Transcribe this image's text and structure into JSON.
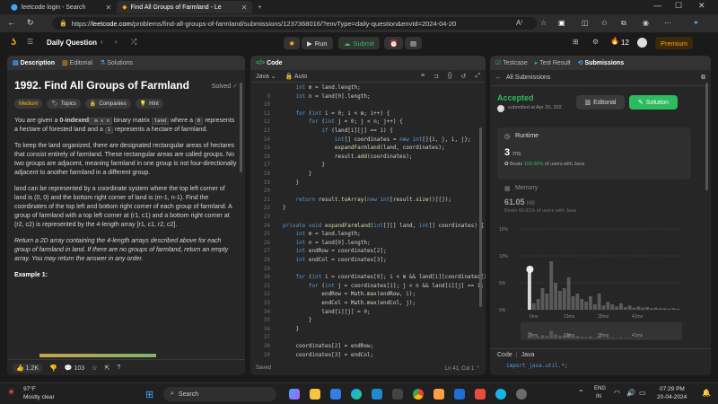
{
  "browser": {
    "tabs": [
      {
        "label": "leetcode login - Search"
      },
      {
        "label": "Find All Groups of Farmland - Le"
      }
    ],
    "url_prefix": "https://",
    "url_host": "leetcode.com",
    "url_path": "/problems/find-all-groups-of-farmland/submissions/1237368016/?envType=daily-question&envId=2024-04-20"
  },
  "header": {
    "daily_label": "Daily Question",
    "run_label": "Run",
    "submit_label": "Submit",
    "streak": "12",
    "premium_label": "Premium"
  },
  "left_panel": {
    "tabs": [
      "Description",
      "Editorial",
      "Solutions"
    ],
    "title": "1992. Find All Groups of Farmland",
    "solved_label": "Solved",
    "pills": [
      "Medium",
      "Topics",
      "Companies",
      "Hint"
    ],
    "p1": {
      "a": "You are given a ",
      "b": "0-indexed",
      "c": " m x n",
      "d": " binary matrix ",
      "e": "land",
      "f": " where a ",
      "g": "0",
      "h": "represents a hectare of forested land and a ",
      "i": "1",
      "j": " represents a hectare of farmland."
    },
    "p2": "To keep the land organized, there are designated rectangular areas of hectares that consist entirely of farmland. These rectangular areas are called groups. No two groups are adjacent, meaning farmland in one group is not four-directionally adjacent to another farmland in a different group.",
    "p3": "land can be represented by a coordinate system where the top left corner of land is (0, 0) and the bottom right corner of land is (m-1, n-1). Find the coordinates of the top left and bottom right corner of each group of farmland. A group of farmland with a top left corner at (r1, c1) and a bottom right corner at (r2, c2) is represented by the 4-length array [r1, c1, r2, c2].",
    "p4": "Return a 2D array containing the 4-length arrays described above for each group of farmland in land. If there are no groups of farmland, return an empty array. You may return the answer in any order.",
    "example_label": "Example 1:",
    "likes": "1.2K",
    "comments": "103"
  },
  "code_panel": {
    "title": "Code",
    "language": "Java",
    "auto_label": "Auto",
    "status_saved": "Saved",
    "cursor_pos": "Ln 41, Col 1",
    "lines": [
      {
        "n": "",
        "t": "    int m = land.length;"
      },
      {
        "n": "9",
        "t": "    int n = land[0].length;"
      },
      {
        "n": "10",
        "t": ""
      },
      {
        "n": "11",
        "t": "    for (int i = 0; i < m; i++) {"
      },
      {
        "n": "12",
        "t": "        for (int j = 0; j < n; j++) {"
      },
      {
        "n": "13",
        "t": "            if (land[i][j] == 1) {"
      },
      {
        "n": "14",
        "t": "                int[] coordinates = new int[]{i, j, i, j};"
      },
      {
        "n": "15",
        "t": "                expandFarmland(land, coordinates);"
      },
      {
        "n": "16",
        "t": "                result.add(coordinates);"
      },
      {
        "n": "17",
        "t": "            }"
      },
      {
        "n": "18",
        "t": "        }"
      },
      {
        "n": "19",
        "t": "    }"
      },
      {
        "n": "20",
        "t": ""
      },
      {
        "n": "21",
        "t": "    return result.toArray(new int[result.size()][]);"
      },
      {
        "n": "22",
        "t": "}"
      },
      {
        "n": "23",
        "t": ""
      },
      {
        "n": "24",
        "t": "private void expandFarmland(int[][] land, int[] coordinates) {"
      },
      {
        "n": "25",
        "t": "    int m = land.length;"
      },
      {
        "n": "26",
        "t": "    int n = land[0].length;"
      },
      {
        "n": "27",
        "t": "    int endRow = coordinates[2];"
      },
      {
        "n": "28",
        "t": "    int endCol = coordinates[3];"
      },
      {
        "n": "29",
        "t": ""
      },
      {
        "n": "30",
        "t": "    for (int i = coordinates[0]; i < m && land[i][coordinates[1]"
      },
      {
        "n": "31",
        "t": "        for (int j = coordinates[1]; j < n && land[i][j] == 1; j"
      },
      {
        "n": "32",
        "t": "            endRow = Math.max(endRow, i);"
      },
      {
        "n": "33",
        "t": "            endCol = Math.max(endCol, j);"
      },
      {
        "n": "34",
        "t": "            land[i][j] = 0;"
      },
      {
        "n": "35",
        "t": "        }"
      },
      {
        "n": "36",
        "t": "    }"
      },
      {
        "n": "37",
        "t": ""
      },
      {
        "n": "38",
        "t": "    coordinates[2] = endRow;"
      },
      {
        "n": "39",
        "t": "    coordinates[3] = endCol;"
      }
    ]
  },
  "right_panel": {
    "tabs": [
      "Testcase",
      "Test Result",
      "Submissions"
    ],
    "back_label": "All Submissions",
    "accepted_label": "Accepted",
    "submitted_at": "submitted at Apr 20, 202",
    "editorial_btn": "Editorial",
    "solution_btn": "Solution",
    "runtime_label": "Runtime",
    "runtime_value": "3",
    "runtime_unit": "ms",
    "runtime_beats_prefix": "Beats",
    "runtime_beats_pct": "100.00%",
    "runtime_beats_suffix": "of users with Java",
    "memory_label": "Memory",
    "memory_value": "61.05",
    "memory_unit": "MB",
    "memory_beats_prefix": "Beats",
    "memory_beats_pct": "49.81%",
    "memory_beats_suffix": "of users with Java",
    "y_ticks": [
      "15%",
      "10%",
      "5%",
      "0%"
    ],
    "x_ticks": [
      "0ms",
      "13ms",
      "28ms",
      "41ms"
    ],
    "mini_x_ticks": [
      "3ms",
      "13ms",
      "28ms",
      "41ms"
    ],
    "code_label": "Code",
    "code_lang": "Java",
    "code_preview": "import java.util.*;"
  },
  "chart_data": {
    "type": "bar",
    "title": "",
    "xlabel": "",
    "ylabel": "",
    "ylim": [
      0,
      15
    ],
    "x_ticks": [
      "0ms",
      "13ms",
      "28ms",
      "41ms"
    ],
    "y_ticks": [
      "15%",
      "10%",
      "5%",
      "0%"
    ],
    "values": [
      7.5,
      1.2,
      2,
      4,
      3,
      9,
      5,
      3.5,
      4,
      6,
      2.5,
      3,
      2,
      1.5,
      2.5,
      1,
      3,
      0.8,
      1.5,
      1,
      0.6,
      1.2,
      0.5,
      0.8,
      0.4,
      0.6,
      0.4,
      0.5,
      0.3,
      0.4,
      0.3,
      0.3,
      0.2,
      0.3,
      0.2
    ]
  },
  "taskbar": {
    "weather_temp": "97°F",
    "weather_desc": "Mostly clear",
    "search_label": "Search",
    "lang_top": "ENG",
    "lang_bottom": "IN",
    "time": "07:29 PM",
    "date": "20-04-2024"
  }
}
